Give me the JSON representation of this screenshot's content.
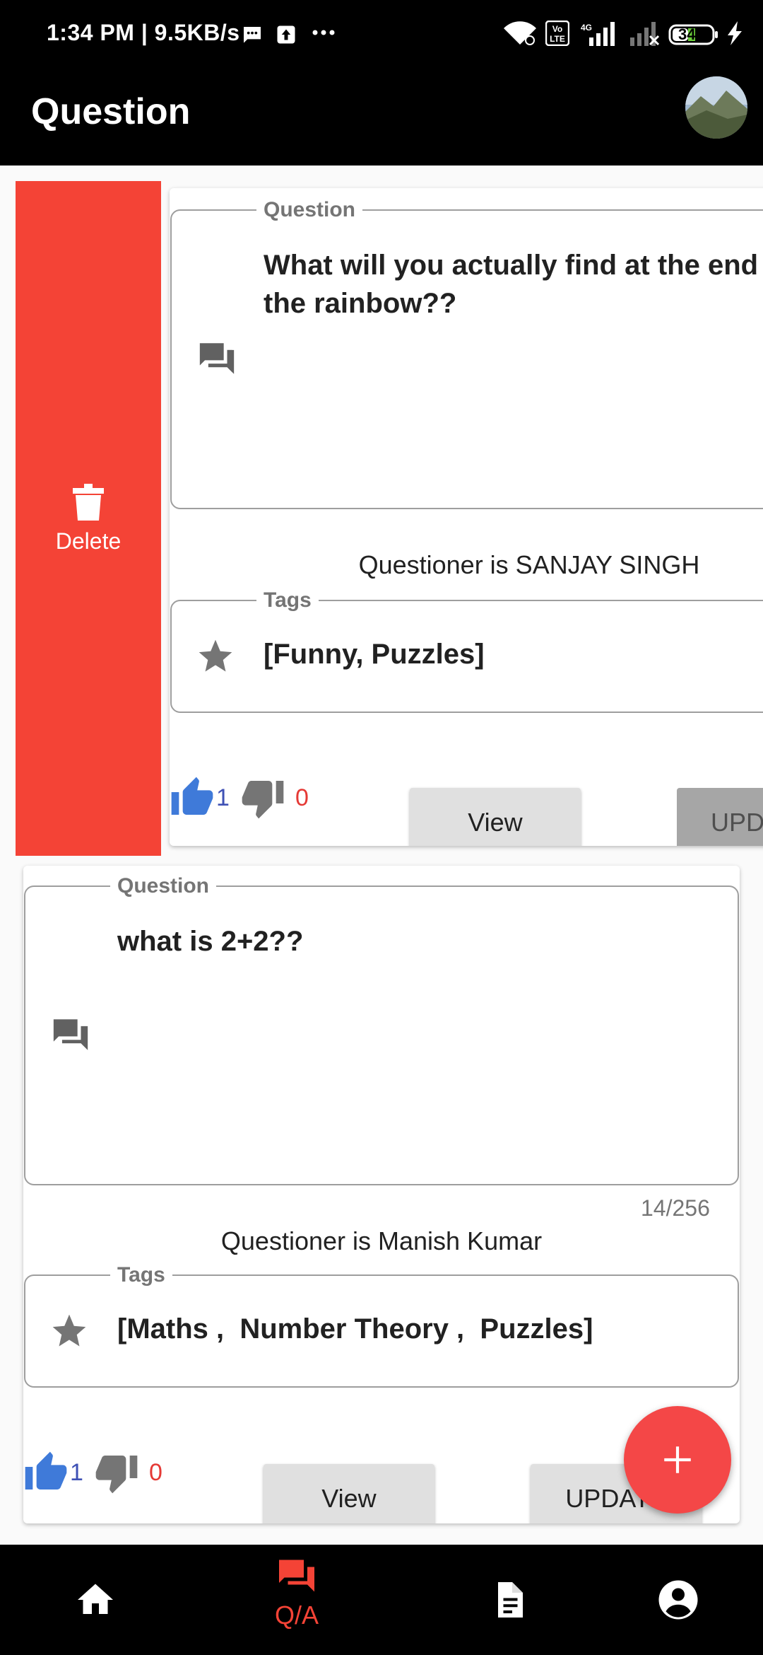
{
  "status_bar": {
    "time_text": "1:34 PM | 9.5KB/s",
    "battery_level": "34"
  },
  "app_bar": {
    "title": "Question"
  },
  "delete_action": {
    "label": "Delete"
  },
  "questions": [
    {
      "question_legend": "Question",
      "question_line1": "What will you actually find at the end of",
      "question_line2": "the rainbow??",
      "questioner": "Questioner is SANJAY SINGH",
      "tags_legend": "Tags",
      "tags": "[Funny, Puzzles]",
      "likes": "1",
      "dislikes": "0",
      "view_label": "View",
      "update_label": "UPDATE"
    },
    {
      "question_legend": "Question",
      "question_line1": "what is 2+2??",
      "counter": "14/256",
      "questioner": "Questioner is Manish Kumar",
      "tags_legend": "Tags",
      "tags": "[Maths ,  Number Theory ,  Puzzles]",
      "likes": "1",
      "dislikes": "0",
      "view_label": "View",
      "update_label": "UPDATE"
    }
  ],
  "bottom_nav": {
    "items": [
      {
        "icon": "home-icon",
        "label": ""
      },
      {
        "icon": "forum-icon",
        "label": "Q/A"
      },
      {
        "icon": "document-icon",
        "label": ""
      },
      {
        "icon": "account-icon",
        "label": ""
      }
    ]
  },
  "colors": {
    "accent_red": "#f44336",
    "like_blue": "#3f51b5",
    "dislike_red": "#e53935"
  }
}
